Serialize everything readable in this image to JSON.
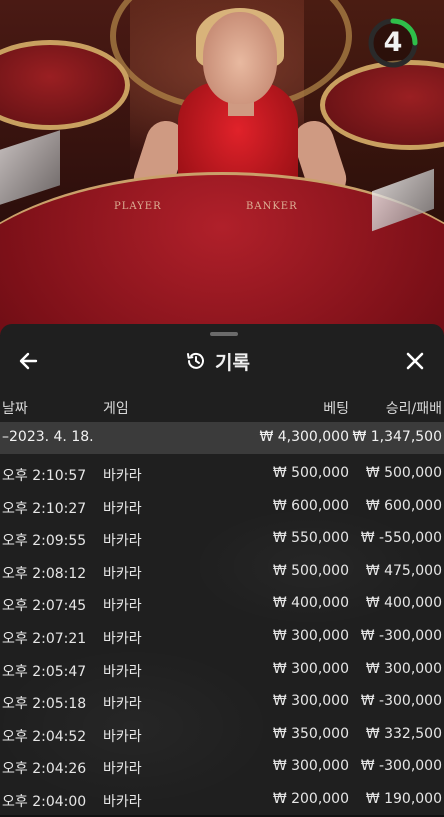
{
  "video": {
    "timer_value": "4",
    "table_labels": {
      "player": "PLAYER",
      "banker": "BANKER"
    },
    "colors": {
      "timer_ring": "#2fbf4a",
      "felt": "#8e1018",
      "dealer_dress": "#c8141c"
    }
  },
  "panel": {
    "title": "기록",
    "icons": {
      "back": "arrow-left-icon",
      "history": "history-clock-icon",
      "close": "close-icon"
    },
    "columns": {
      "date": "날짜",
      "game": "게임",
      "bet": "베팅",
      "result": "승리/패배"
    },
    "summary": {
      "date": "–2023. 4. 18.",
      "bet": "₩ 4,300,000",
      "result": "₩ 1,347,500"
    },
    "rows": [
      {
        "time": "오후 2:10:57",
        "game": "바카라",
        "bet": "₩ 500,000",
        "result": "₩ 500,000"
      },
      {
        "time": "오후 2:10:27",
        "game": "바카라",
        "bet": "₩ 600,000",
        "result": "₩ 600,000"
      },
      {
        "time": "오후 2:09:55",
        "game": "바카라",
        "bet": "₩ 550,000",
        "result": "₩ -550,000"
      },
      {
        "time": "오후 2:08:12",
        "game": "바카라",
        "bet": "₩ 500,000",
        "result": "₩ 475,000"
      },
      {
        "time": "오후 2:07:45",
        "game": "바카라",
        "bet": "₩ 400,000",
        "result": "₩ 400,000"
      },
      {
        "time": "오후 2:07:21",
        "game": "바카라",
        "bet": "₩ 300,000",
        "result": "₩ -300,000"
      },
      {
        "time": "오후 2:05:47",
        "game": "바카라",
        "bet": "₩ 300,000",
        "result": "₩ 300,000"
      },
      {
        "time": "오후 2:05:18",
        "game": "바카라",
        "bet": "₩ 300,000",
        "result": "₩ -300,000"
      },
      {
        "time": "오후 2:04:52",
        "game": "바카라",
        "bet": "₩ 350,000",
        "result": "₩ 332,500"
      },
      {
        "time": "오후 2:04:26",
        "game": "바카라",
        "bet": "₩ 300,000",
        "result": "₩ -300,000"
      },
      {
        "time": "오후 2:04:00",
        "game": "바카라",
        "bet": "₩ 200,000",
        "result": "₩ 190,000"
      }
    ]
  }
}
